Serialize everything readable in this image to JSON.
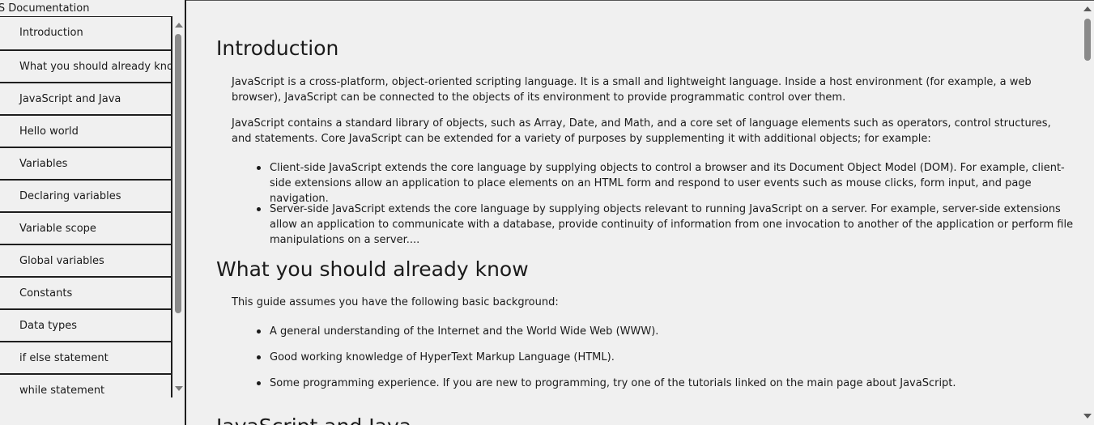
{
  "sidebar": {
    "title": "JS Documentation",
    "items": [
      {
        "label": "Introduction"
      },
      {
        "label": "What you should already know"
      },
      {
        "label": "JavaScript and Java"
      },
      {
        "label": "Hello world"
      },
      {
        "label": "Variables"
      },
      {
        "label": "Declaring variables"
      },
      {
        "label": "Variable scope"
      },
      {
        "label": "Global variables"
      },
      {
        "label": "Constants"
      },
      {
        "label": "Data types"
      },
      {
        "label": "if else statement"
      },
      {
        "label": "while statement"
      }
    ]
  },
  "main": {
    "sections": [
      {
        "title": "Introduction",
        "paragraphs": [
          "JavaScript is a cross-platform, object-oriented scripting language. It is a small and lightweight language. Inside a host environment (for example, a web browser), JavaScript can be connected to the objects of its environment to provide programmatic control over them.",
          "JavaScript contains a standard library of objects, such as Array, Date, and Math, and a core set of language elements such as operators, control structures, and statements. Core JavaScript can be extended for a variety of purposes by supplementing it with additional objects; for example:"
        ],
        "bullets": [
          "Client-side JavaScript extends the core language by supplying objects to control a browser and its Document Object Model (DOM). For example, client-side extensions allow an application to place elements on an HTML form and respond to user events such as mouse clicks, form input, and page navigation.",
          "Server-side JavaScript extends the core language by supplying objects relevant to running JavaScript on a server. For example, server-side extensions allow an application to communicate with a database, provide continuity of information from one invocation to another of the application or perform file manipulations on a server...."
        ]
      },
      {
        "title": "What you should already know",
        "paragraphs": [
          "This guide assumes you have the following basic background:"
        ],
        "bullets": [
          "A general understanding of the Internet and the World Wide Web (WWW).",
          "Good working knowledge of HyperText Markup Language (HTML).",
          "Some programming experience. If you are new to programming, try one of the tutorials linked on the main page about JavaScript."
        ]
      },
      {
        "title": "JavaScript and Java"
      }
    ]
  }
}
